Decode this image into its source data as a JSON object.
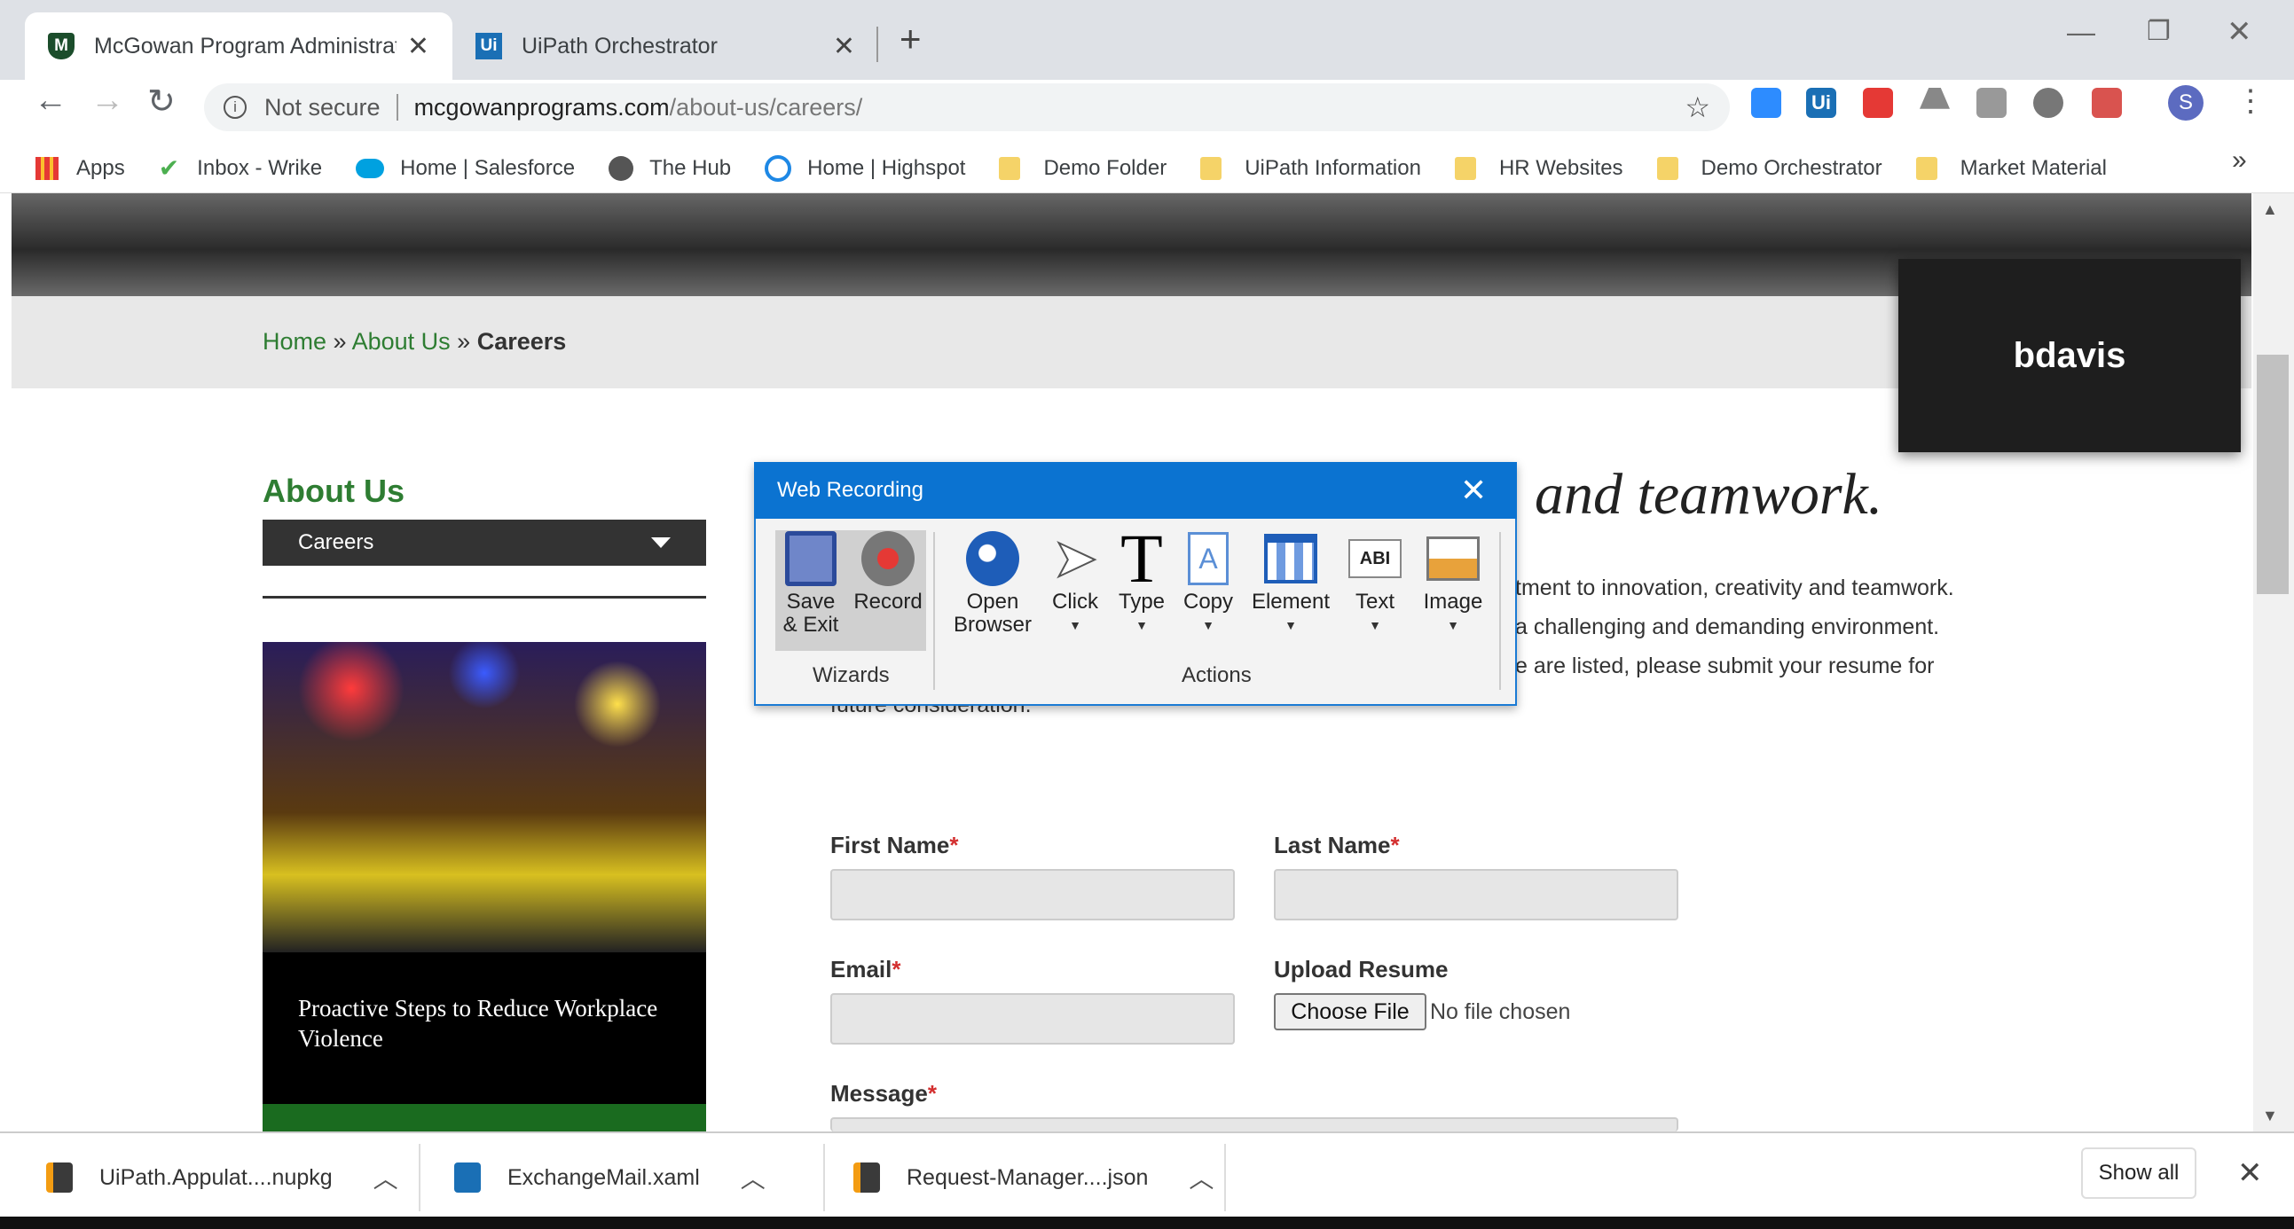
{
  "tabs": [
    {
      "title": "McGowan Program Administrato",
      "icon": "mcgowan-shield-icon",
      "active": true
    },
    {
      "title": "UiPath Orchestrator",
      "icon": "uipath-icon",
      "active": false
    }
  ],
  "new_tab": "+",
  "omnibox": {
    "security": "Not secure",
    "domain": "mcgowanprograms.com",
    "path": "/about-us/careers/"
  },
  "bookmarks": [
    {
      "label": "Apps",
      "icon": "apps-grid-icon"
    },
    {
      "label": "Inbox - Wrike",
      "icon": "wrike-check-icon"
    },
    {
      "label": "Home | Salesforce",
      "icon": "salesforce-cloud-icon"
    },
    {
      "label": "The Hub",
      "icon": "globe-icon"
    },
    {
      "label": "Home | Highspot",
      "icon": "highspot-icon"
    },
    {
      "label": "Demo Folder",
      "icon": "folder-icon"
    },
    {
      "label": "UiPath Information",
      "icon": "folder-icon"
    },
    {
      "label": "HR Websites",
      "icon": "folder-icon"
    },
    {
      "label": "Demo Orchestrator",
      "icon": "folder-icon"
    },
    {
      "label": "Market Material",
      "icon": "folder-icon"
    }
  ],
  "bookmarks_more": "»",
  "profile_initial": "S",
  "page": {
    "breadcrumb": {
      "home": "Home",
      "sep": "»",
      "about": "About Us",
      "current": "Careers"
    },
    "sidebar": {
      "heading": "About Us",
      "dropdown": "Careers",
      "promo_text": "Proactive Steps to Reduce Workplace Violence"
    },
    "heading": "and teamwork.",
    "paragraph_lines": [
      "tment to innovation, creativity and teamwork.",
      "a challenging and demanding environment.",
      "e are listed, please submit your resume for",
      "future consideration."
    ],
    "form": {
      "first_name": "First Name",
      "last_name": "Last Name",
      "email": "Email",
      "upload": "Upload Resume",
      "choose_file": "Choose File",
      "no_file": "No file chosen",
      "message": "Message",
      "required_mark": "*"
    }
  },
  "user_overlay": "bdavis",
  "web_recording": {
    "title": "Web Recording",
    "buttons": [
      {
        "label": "Save\n& Exit",
        "icon": "floppy-disk-icon"
      },
      {
        "label": "Record",
        "icon": "record-icon"
      },
      {
        "label": "Open\nBrowser",
        "icon": "open-browser-globe-icon"
      },
      {
        "label": "Click",
        "icon": "cursor-arrow-icon"
      },
      {
        "label": "Type",
        "icon": "type-t-icon"
      },
      {
        "label": "Copy",
        "icon": "copy-document-icon"
      },
      {
        "label": "Element",
        "icon": "element-window-icon"
      },
      {
        "label": "Text",
        "icon": "text-abi-icon"
      },
      {
        "label": "Image",
        "icon": "image-landscape-icon"
      }
    ],
    "groups": {
      "wizards": "Wizards",
      "actions": "Actions"
    },
    "text_icon_label": "ABI"
  },
  "downloads": [
    {
      "name": "UiPath.Appulat....nupkg",
      "icon": "sublime-file-icon"
    },
    {
      "name": "ExchangeMail.xaml",
      "icon": "uipath-file-icon"
    },
    {
      "name": "Request-Manager....json",
      "icon": "sublime-file-icon"
    }
  ],
  "show_all": "Show all",
  "colors": {
    "accent_green": "#2e7d32",
    "dialog_blue": "#0b73d1",
    "required_red": "#d32f2f"
  }
}
